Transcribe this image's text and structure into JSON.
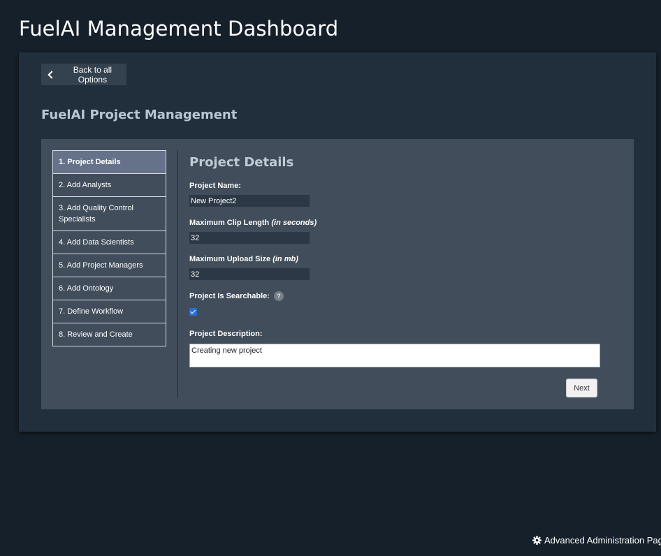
{
  "page": {
    "title": "FuelAI Management Dashboard"
  },
  "back_button": {
    "label": "Back to all Options"
  },
  "section": {
    "title": "FuelAI Project Management"
  },
  "steps": [
    {
      "label": "1. Project Details",
      "active": true
    },
    {
      "label": "2. Add Analysts"
    },
    {
      "label": "3. Add Quality Control Specialists"
    },
    {
      "label": "4. Add Data Scientists"
    },
    {
      "label": "5. Add Project Managers"
    },
    {
      "label": "6. Add Ontology"
    },
    {
      "label": "7. Define Workflow"
    },
    {
      "label": "8. Review and Create"
    }
  ],
  "form": {
    "title": "Project Details",
    "project_name": {
      "label": "Project Name:",
      "value": "New Project2"
    },
    "max_clip_length": {
      "label": "Maximum Clip Length",
      "unit": "(in seconds)",
      "value": "32"
    },
    "max_upload_size": {
      "label": "Maximum Upload Size",
      "unit": "(in mb)",
      "value": "32"
    },
    "searchable": {
      "label": "Project Is Searchable:",
      "help": "?",
      "checked": true
    },
    "description": {
      "label": "Project Description:",
      "value": "Creating new project"
    },
    "next_label": "Next"
  },
  "footer": {
    "admin_link": "Advanced Administration Page"
  },
  "colors": {
    "background": "#16202a",
    "card": "#212f3c",
    "panel": "#414d5b",
    "active_step": "#66718a",
    "checkbox": "#2a6fd6"
  }
}
